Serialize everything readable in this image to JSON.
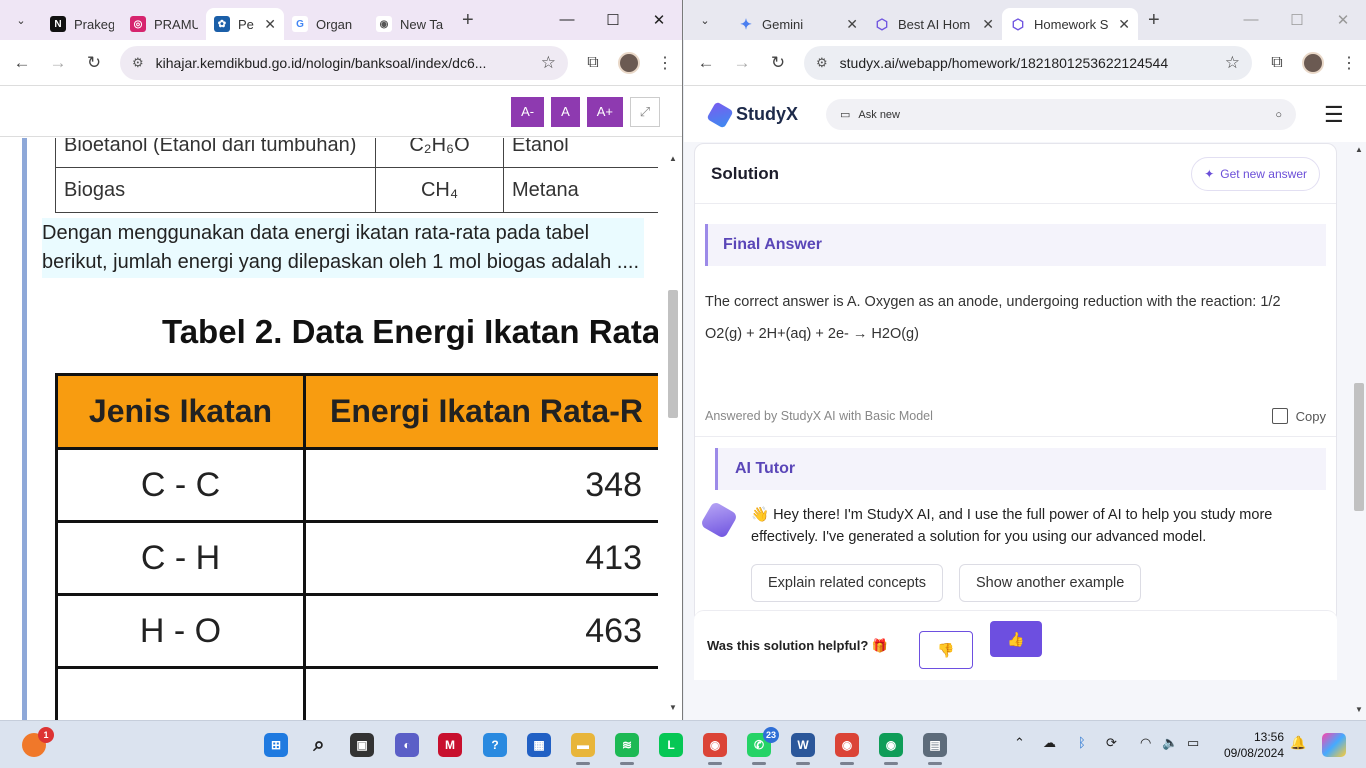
{
  "left_window": {
    "tabs": [
      {
        "title": "Prakeg",
        "icon": "notion-icon",
        "color": "#111111",
        "glyph": "N"
      },
      {
        "title": "PRAMU",
        "icon": "instagram-icon",
        "color": "#d6246e",
        "glyph": "◎"
      },
      {
        "title": "Pe",
        "icon": "kemdikbud-icon",
        "color": "#1b5fa8",
        "glyph": "✿"
      },
      {
        "title": "Organ",
        "icon": "google-icon",
        "color": "#4285f4",
        "glyph": "G"
      },
      {
        "title": "New Ta",
        "icon": "chrome-icon",
        "color": "#666666",
        "glyph": "◉"
      }
    ],
    "url": "kihajar.kemdikbud.go.id/nologin/banksoal/index/dc6...",
    "font_buttons": [
      "A-",
      "A",
      "A+"
    ],
    "table1": [
      [
        "Bioetanol (Etanol dari tumbuhan)",
        "C₂H₆O",
        "Etanol"
      ],
      [
        "Biogas",
        "CH₄",
        "Metana"
      ]
    ],
    "question": "Dengan menggunakan data energi ikatan rata-rata pada tabel berikut, jumlah energi yang dilepaskan oleh 1 mol biogas adalah ....",
    "table2": {
      "title": "Tabel 2. Data Energi Ikatan Rata",
      "headers": [
        "Jenis Ikatan",
        "Energi Ikatan Rata-R"
      ],
      "rows": [
        [
          "C - C",
          "348"
        ],
        [
          "C - H",
          "413"
        ],
        [
          "H - O",
          "463"
        ]
      ]
    }
  },
  "right_window": {
    "tabs": [
      {
        "title": "Gemini",
        "icon": "gemini-icon",
        "color": "#4a7ef0",
        "glyph": "✦"
      },
      {
        "title": "Best AI Hom",
        "icon": "studyx-icon",
        "color": "#6f54e0",
        "glyph": "⬡"
      },
      {
        "title": "Homework S",
        "icon": "studyx-icon",
        "color": "#6f54e0",
        "glyph": "⬡"
      }
    ],
    "url": "studyx.ai/webapp/homework/1821801253622124544",
    "brand": "StudyX",
    "ask_placeholder": "Ask new",
    "solution_title": "Solution",
    "get_new_answer": "Get new answer",
    "final_answer_title": "Final Answer",
    "final_answer_line1": "The correct answer is A. Oxygen as an anode, undergoing reduction with the reaction: 1/2",
    "final_answer_line2": "O2(g) + 2H+(aq) + 2e- → H2O(g)",
    "answered_by": "Answered by StudyX AI with Basic Model",
    "copy_label": "Copy",
    "tutor_title": "AI Tutor",
    "tutor_message": "👋 Hey there! I'm StudyX AI, and I use the full power of AI to help you study more effectively. I've generated a solution for you using our advanced model.",
    "chips": [
      "Explain related concepts",
      "Show another example"
    ],
    "helpful_question": "Was this solution helpful? 🎁"
  },
  "taskbar": {
    "time": "13:56",
    "date": "09/08/2024",
    "badges": {
      "launcher": "1",
      "whatsapp": "23"
    },
    "apps": [
      {
        "name": "windows-start-icon",
        "color": "#1f7ae0",
        "glyph": "⊞"
      },
      {
        "name": "search-icon",
        "color": "#dbe3ef",
        "glyph": "⌕"
      },
      {
        "name": "task-view-icon",
        "color": "#333333",
        "glyph": "▣"
      },
      {
        "name": "meet-icon",
        "color": "#5b5fc7",
        "glyph": "◐"
      },
      {
        "name": "mcafee-icon",
        "color": "#c8102e",
        "glyph": "M"
      },
      {
        "name": "help-icon",
        "color": "#2a8ae0",
        "glyph": "?"
      },
      {
        "name": "store-icon",
        "color": "#2160c4",
        "glyph": "▦"
      },
      {
        "name": "file-explorer-icon",
        "color": "#e8b53a",
        "glyph": "▬"
      },
      {
        "name": "spotify-icon",
        "color": "#1db954",
        "glyph": "≋"
      },
      {
        "name": "line-icon",
        "color": "#06c755",
        "glyph": "L"
      },
      {
        "name": "chrome-icon",
        "color": "#db4437",
        "glyph": "◉"
      },
      {
        "name": "whatsapp-icon",
        "color": "#25d366",
        "glyph": "✆"
      },
      {
        "name": "word-icon",
        "color": "#2b579a",
        "glyph": "W"
      },
      {
        "name": "chrome-profile-icon",
        "color": "#db4437",
        "glyph": "◉"
      },
      {
        "name": "chrome-profile-2-icon",
        "color": "#0f9d58",
        "glyph": "◉"
      },
      {
        "name": "calculator-icon",
        "color": "#5d6b7a",
        "glyph": "▤"
      }
    ]
  }
}
